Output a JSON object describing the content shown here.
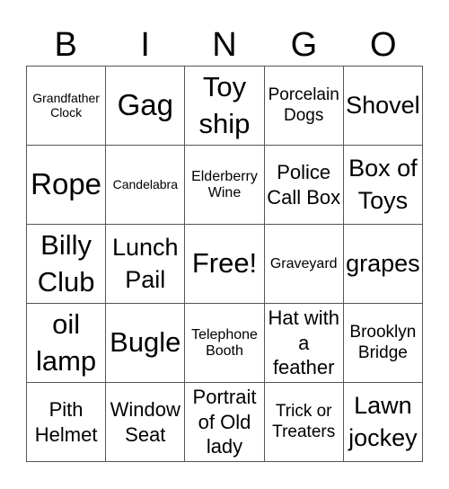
{
  "header": [
    "B",
    "I",
    "N",
    "G",
    "O"
  ],
  "cells": [
    {
      "text": "Grandfather Clock",
      "size": "s14"
    },
    {
      "text": "Gag",
      "size": "s34"
    },
    {
      "text": "Toy ship",
      "size": "s30"
    },
    {
      "text": "Porcelain Dogs",
      "size": "s18"
    },
    {
      "text": "Shovel",
      "size": "s26"
    },
    {
      "text": "Rope",
      "size": "s34"
    },
    {
      "text": "Candelabra",
      "size": "s14"
    },
    {
      "text": "Elderberry Wine",
      "size": "s16"
    },
    {
      "text": "Police Call Box",
      "size": "s22"
    },
    {
      "text": "Box of Toys",
      "size": "s26"
    },
    {
      "text": "Billy Club",
      "size": "s30"
    },
    {
      "text": "Lunch Pail",
      "size": "s26"
    },
    {
      "text": "Free!",
      "size": "s30"
    },
    {
      "text": "Graveyard",
      "size": "s16"
    },
    {
      "text": "grapes",
      "size": "s26"
    },
    {
      "text": "oil lamp",
      "size": "s30"
    },
    {
      "text": "Bugle",
      "size": "s30"
    },
    {
      "text": "Telephone Booth",
      "size": "s16"
    },
    {
      "text": "Hat with a feather",
      "size": "s22"
    },
    {
      "text": "Brooklyn Bridge",
      "size": "s18"
    },
    {
      "text": "Pith Helmet",
      "size": "s22"
    },
    {
      "text": "Window Seat",
      "size": "s22"
    },
    {
      "text": "Portrait of Old lady",
      "size": "s22"
    },
    {
      "text": "Trick or Treaters",
      "size": "s18"
    },
    {
      "text": "Lawn jockey",
      "size": "s26"
    }
  ]
}
